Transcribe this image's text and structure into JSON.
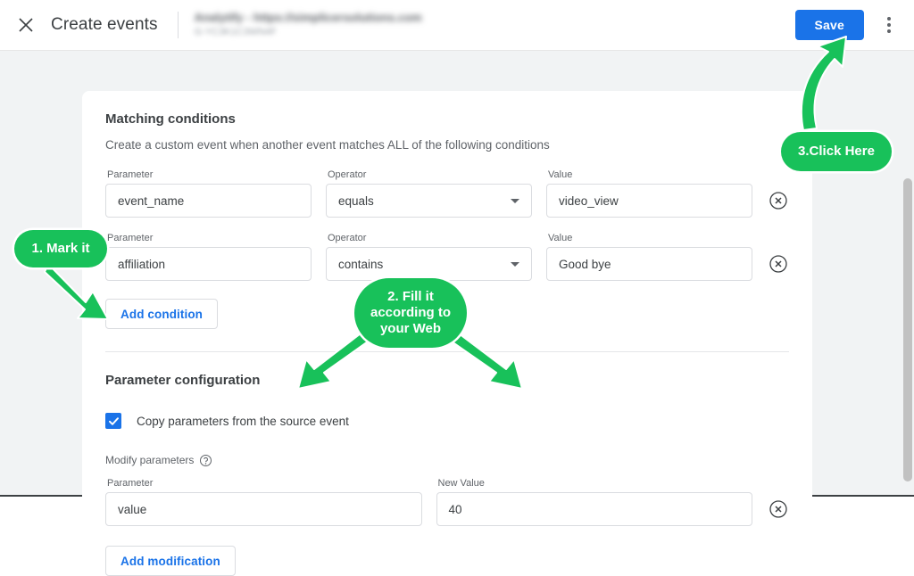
{
  "topbar": {
    "close_icon": "close-icon",
    "title": "Create events",
    "property_name": "Analytify - https://simplicersolutions.com",
    "property_id": "G-YC3K1C3WN4F",
    "save_label": "Save",
    "more_icon": "more-vert-icon"
  },
  "matching": {
    "title": "Matching conditions",
    "subtitle": "Create a custom event when another event matches ALL of the following conditions",
    "labels": {
      "parameter": "Parameter",
      "operator": "Operator",
      "value": "Value"
    },
    "conditions": [
      {
        "parameter": "event_name",
        "operator": "equals",
        "value": "video_view"
      },
      {
        "parameter": "affiliation",
        "operator": "contains",
        "value": "Good bye"
      }
    ],
    "add_condition_label": "Add condition"
  },
  "parameter_config": {
    "title": "Parameter configuration",
    "copy_checkbox_label": "Copy parameters from the source event",
    "copy_checkbox_checked": true,
    "modify_label": "Modify parameters",
    "help_icon": "help-icon",
    "labels": {
      "parameter": "Parameter",
      "new_value": "New Value"
    },
    "modifications": [
      {
        "parameter": "value",
        "new_value": "40"
      }
    ],
    "add_modification_label": "Add modification"
  },
  "annotations": {
    "accent_color": "#18c15a",
    "items": [
      {
        "id": "mark-it",
        "text": "1. Mark it"
      },
      {
        "id": "fill-it",
        "text": "2. Fill it\naccording to\nyour Web"
      },
      {
        "id": "click-here",
        "text": "3.Click Here"
      }
    ]
  },
  "colors": {
    "primary_blue": "#1a73e8",
    "page_background": "#f1f3f4",
    "card_background": "#ffffff",
    "annotation_green": "#18c15a"
  }
}
